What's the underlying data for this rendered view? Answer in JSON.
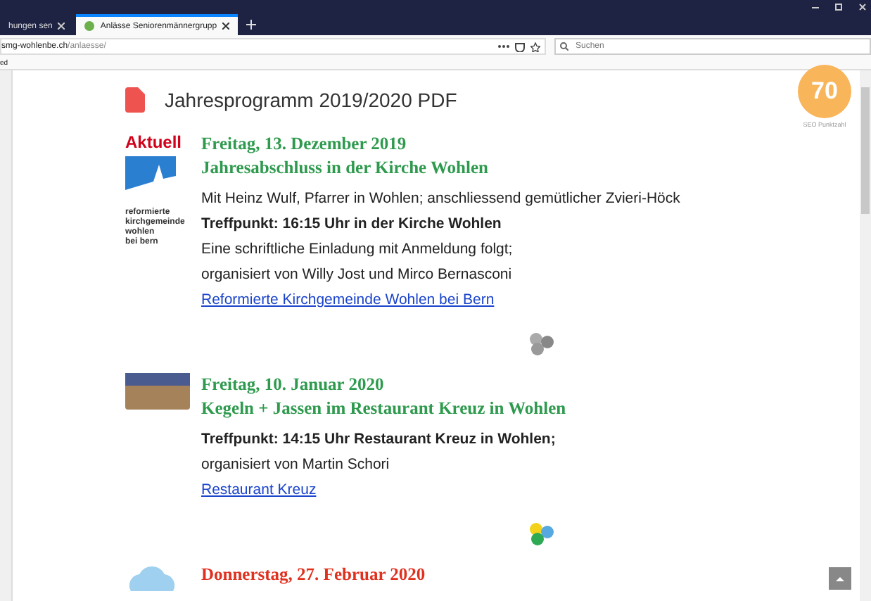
{
  "browser": {
    "tabs": [
      {
        "label": "hungen sen",
        "selected": false
      },
      {
        "label": "Anlässe Seniorenmännergrupp",
        "selected": true
      }
    ],
    "url": {
      "host": "smg-wohlenbe.ch",
      "path": "/anlaesse/"
    },
    "search": {
      "placeholder": "Suchen"
    },
    "bookmarks": [
      "ed"
    ]
  },
  "page": {
    "pdf_link": "Jahresprogramm 2019/2020 PDF",
    "seo": {
      "score": "70",
      "label": "SEO Punktzahl"
    },
    "events": [
      {
        "badge": "Aktuell",
        "kind": "logo",
        "logo_text": [
          "reformierte",
          "kirchgemeinde",
          "wohlen",
          "bei bern"
        ],
        "date": "Freitag, 13. Dezember 2019",
        "color": "#2e9a4e",
        "title": "Jahresabschluss in der Kirche Wohlen",
        "lines": [
          {
            "text": "Mit Heinz Wulf, Pfarrer in Wohlen; anschliessend gemütlicher Zvieri-Höck",
            "bold": false
          },
          {
            "text": "Treffpunkt: 16:15 Uhr in der Kirche Wohlen",
            "bold": true
          },
          {
            "text": "Eine schriftliche Einladung mit Anmeldung folgt;",
            "bold": false
          },
          {
            "text": "organisiert von Willy Jost und Mirco Bernasconi",
            "bold": false
          }
        ],
        "link": "Reformierte Kirchgemeinde Wohlen bei Bern",
        "divider": {
          "kind": "grey"
        }
      },
      {
        "kind": "photo",
        "date": "Freitag, 10. Januar 2020",
        "color": "#2e9a4e",
        "title": "Kegeln + Jassen im Restaurant Kreuz in Wohlen",
        "lines": [
          {
            "text": "Treffpunkt: 14:15 Uhr Restaurant Kreuz in Wohlen;",
            "bold": true
          },
          {
            "text": "organisiert von Martin Schori",
            "bold": false
          }
        ],
        "link": "Restaurant Kreuz",
        "divider": {
          "kind": "colour"
        }
      },
      {
        "kind": "illustration",
        "date": "Donnerstag, 27. Februar 2020",
        "color": "#e0301e"
      }
    ]
  }
}
